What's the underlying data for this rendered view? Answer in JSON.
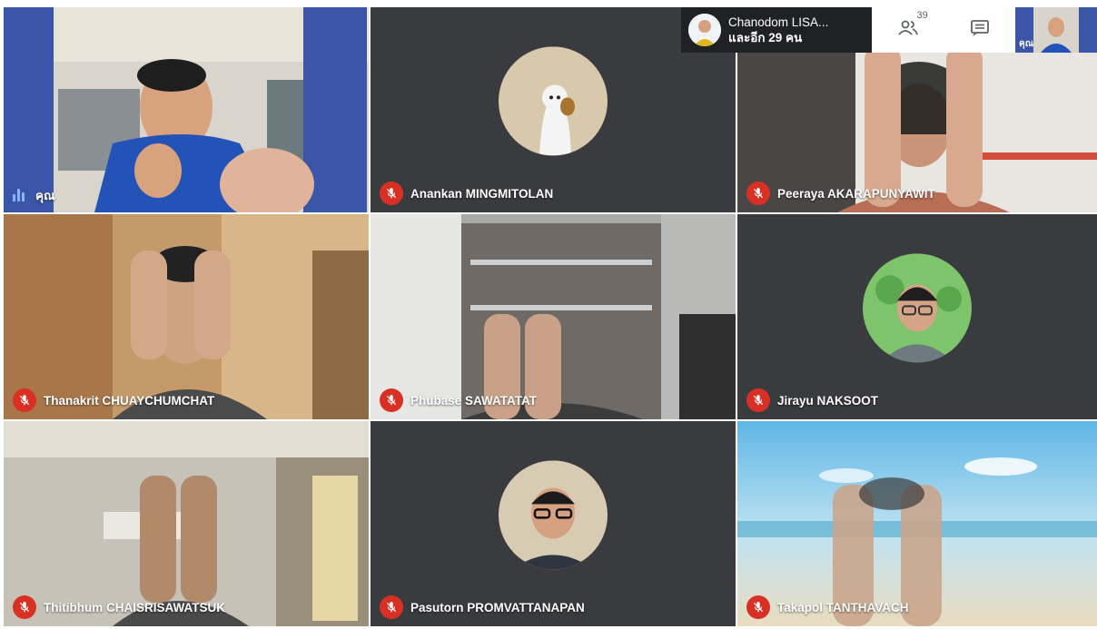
{
  "header": {
    "presenter_name": "Chanodom LISA...",
    "presenter_sub": "และอีก 29 คน",
    "participant_count": "39",
    "people_icon": "people-icon",
    "chat_icon": "chat-icon",
    "self_thumb_label": "คุณ"
  },
  "tiles": [
    {
      "name": "คุณ",
      "muted": false,
      "type": "video"
    },
    {
      "name": "Anankan MINGMITOLAN",
      "muted": true,
      "type": "avatar"
    },
    {
      "name": "Peeraya AKARAPUNYAWIT",
      "muted": true,
      "type": "video"
    },
    {
      "name": "Thanakrit CHUAYCHUMCHAT",
      "muted": true,
      "type": "video"
    },
    {
      "name": "Phubase SAWATATAT",
      "muted": true,
      "type": "video"
    },
    {
      "name": "Jirayu NAKSOOT",
      "muted": true,
      "type": "avatar"
    },
    {
      "name": "Thitibhum CHAISRISAWATSUK",
      "muted": true,
      "type": "video"
    },
    {
      "name": "Pasutorn PROMVATTANAPAN",
      "muted": true,
      "type": "avatar"
    },
    {
      "name": "Takapol TANTHAVACH",
      "muted": true,
      "type": "video"
    }
  ],
  "colors": {
    "mute": "#d93025",
    "tile_dark": "#3a3b3e",
    "audio": "#8ab4f8"
  }
}
